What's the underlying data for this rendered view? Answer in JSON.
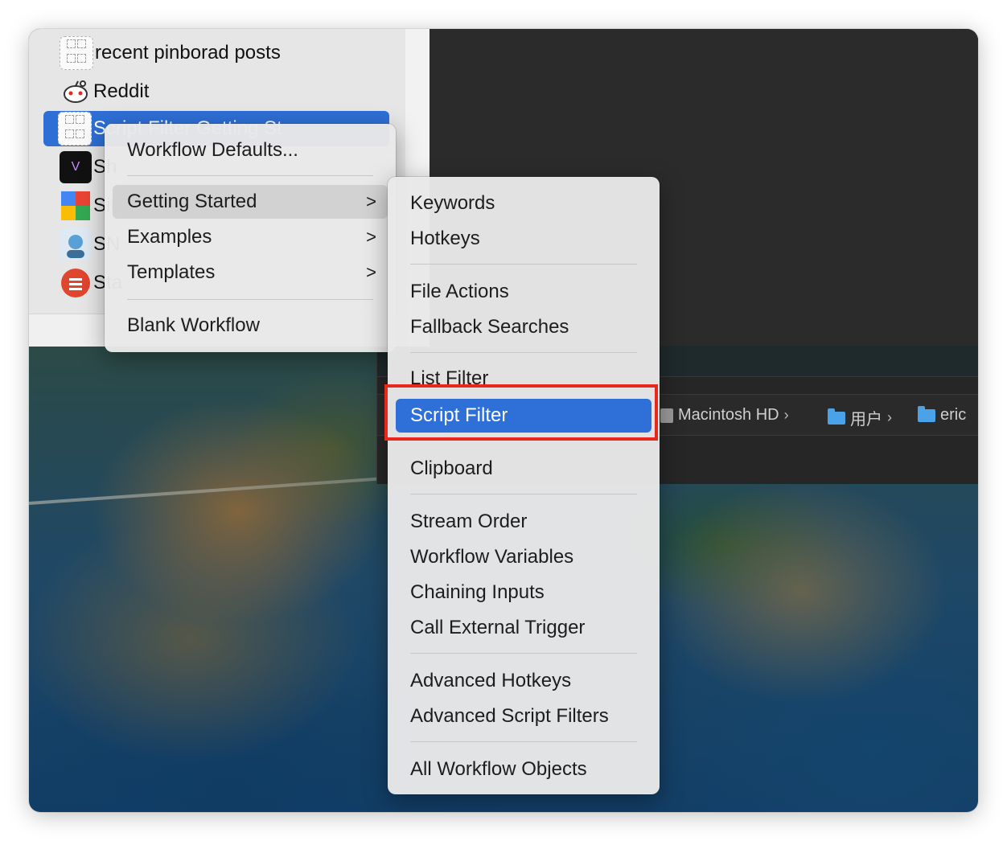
{
  "workflow_list": {
    "items": [
      {
        "label": "recent pinborad posts",
        "icon": "workflow-placeholder-icon"
      },
      {
        "label": "Reddit",
        "icon": "reddit-icon"
      },
      {
        "label": "Script Filter Getting St",
        "icon": "workflow-placeholder-icon",
        "selected": true
      },
      {
        "label": "Sh",
        "icon": "vsh-icon"
      },
      {
        "label": "Sit",
        "icon": "google-icon"
      },
      {
        "label": "SN",
        "icon": "avatar-icon"
      },
      {
        "label": "Sta",
        "icon": "stack-icon"
      }
    ]
  },
  "main_menu": {
    "workflow_defaults": "Workflow Defaults...",
    "getting_started": "Getting Started",
    "examples": "Examples",
    "templates": "Templates",
    "blank_workflow": "Blank Workflow",
    "submenu_arrow": ">"
  },
  "submenu": {
    "keywords": "Keywords",
    "hotkeys": "Hotkeys",
    "file_actions": "File Actions",
    "fallback_searches": "Fallback Searches",
    "list_filter": "List Filter",
    "script_filter": "Script Filter",
    "clipboard": "Clipboard",
    "stream_order": "Stream Order",
    "workflow_variables": "Workflow Variables",
    "chaining_inputs": "Chaining Inputs",
    "call_external_trigger": "Call External Trigger",
    "advanced_hotkeys": "Advanced Hotkeys",
    "advanced_script_filters": "Advanced Script Filters",
    "all_workflow_objects": "All Workflow Objects"
  },
  "finder_path": {
    "disk": "Macintosh HD",
    "folder1": "用户",
    "folder2": "eric",
    "separator": "›"
  },
  "colors": {
    "selection_blue": "#2f6fd8",
    "highlight_red": "#e8281b"
  }
}
